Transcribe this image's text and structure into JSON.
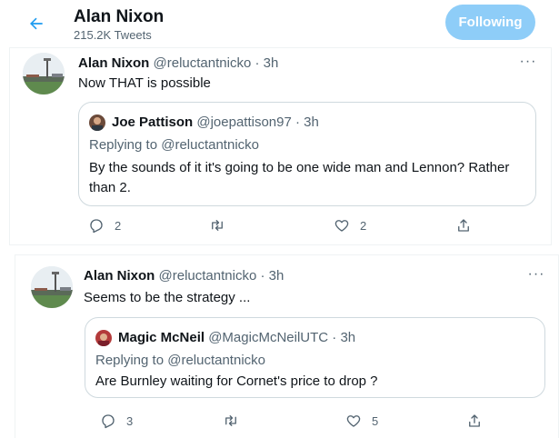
{
  "header": {
    "title": "Alan Nixon",
    "tweet_count": "215.2K Tweets",
    "follow_label": "Following"
  },
  "colors": {
    "accent": "#1d9bf0",
    "follow_bg": "#8ecdf8",
    "muted_text": "#536471",
    "border": "#cfd9de"
  },
  "tweets": [
    {
      "author_name": "Alan Nixon",
      "handle": "@reluctantnicko",
      "dot": "·",
      "time": "3h",
      "more": "···",
      "text": "Now THAT is possible",
      "quote": {
        "author_name": "Joe Pattison",
        "handle": "@joepattison97",
        "dot": "·",
        "time": "3h",
        "replying_prefix": "Replying to",
        "replying_to": "@reluctantnicko",
        "text": "By the sounds of it it's going to be one wide man and Lennon? Rather than 2."
      },
      "actions": {
        "replies": "2",
        "retweets": "",
        "likes": "2"
      }
    },
    {
      "author_name": "Alan Nixon",
      "handle": "@reluctantnicko",
      "dot": "·",
      "time": "3h",
      "more": "···",
      "text": "Seems to be the strategy ...",
      "quote": {
        "author_name": "Magic McNeil",
        "handle": "@MagicMcNeilUTC",
        "dot": "·",
        "time": "3h",
        "replying_prefix": "Replying to",
        "replying_to": "@reluctantnicko",
        "text": "Are Burnley waiting for Cornet's price to drop ?"
      },
      "actions": {
        "replies": "3",
        "retweets": "",
        "likes": "5"
      }
    }
  ],
  "icons": {
    "back": "arrow-left-icon",
    "reply": "reply-icon",
    "retweet": "retweet-icon",
    "like": "heart-icon",
    "share": "share-icon",
    "more": "more-icon"
  }
}
